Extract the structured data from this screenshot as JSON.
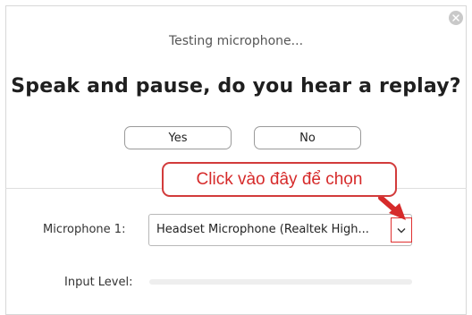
{
  "dialog": {
    "status_text": "Testing microphone...",
    "question": "Speak and pause, do you hear a replay?",
    "buttons": {
      "yes": "Yes",
      "no": "No"
    }
  },
  "annotation": {
    "callout_text": "Click vào đây để chọn",
    "color": "#d62a2a"
  },
  "microphone": {
    "label": "Microphone 1:",
    "selected": "Headset Microphone (Realtek High...",
    "dropdown_icon": "chevron-down-icon"
  },
  "input_level": {
    "label": "Input Level:",
    "level": 0
  },
  "icons": {
    "close": "close-icon"
  }
}
